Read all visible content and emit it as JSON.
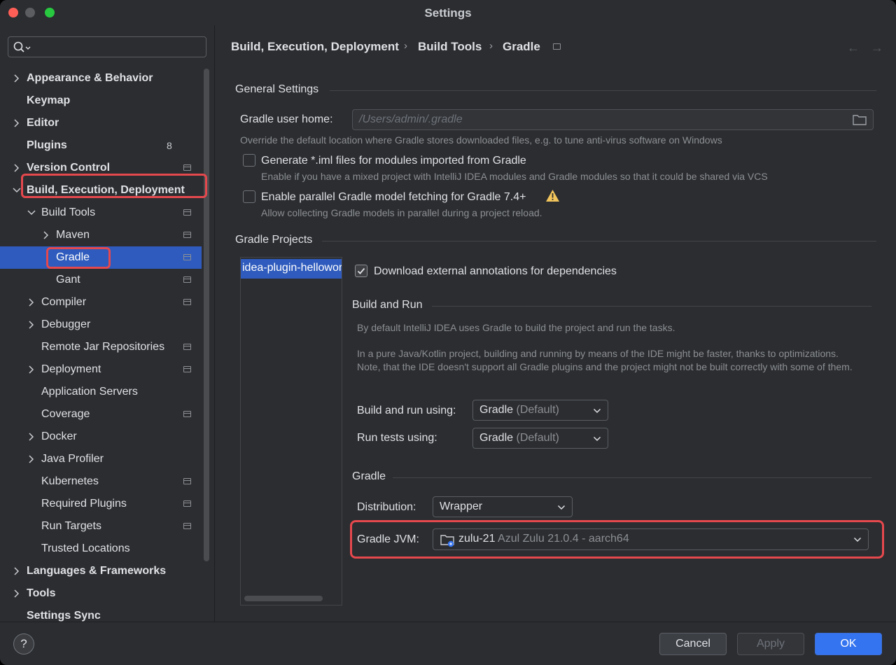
{
  "window": {
    "title": "Settings"
  },
  "sidebar": {
    "items": [
      {
        "label": "Appearance & Behavior"
      },
      {
        "label": "Keymap"
      },
      {
        "label": "Editor"
      },
      {
        "label": "Plugins",
        "badge": "8"
      },
      {
        "label": "Version Control"
      },
      {
        "label": "Build, Execution, Deployment"
      },
      {
        "label": "Build Tools"
      },
      {
        "label": "Maven"
      },
      {
        "label": "Gradle"
      },
      {
        "label": "Gant"
      },
      {
        "label": "Compiler"
      },
      {
        "label": "Debugger"
      },
      {
        "label": "Remote Jar Repositories"
      },
      {
        "label": "Deployment"
      },
      {
        "label": "Application Servers"
      },
      {
        "label": "Coverage"
      },
      {
        "label": "Docker"
      },
      {
        "label": "Java Profiler"
      },
      {
        "label": "Kubernetes"
      },
      {
        "label": "Required Plugins"
      },
      {
        "label": "Run Targets"
      },
      {
        "label": "Trusted Locations"
      },
      {
        "label": "Languages & Frameworks"
      },
      {
        "label": "Tools"
      },
      {
        "label": "Settings Sync"
      }
    ]
  },
  "breadcrumb": [
    "Build, Execution, Deployment",
    "Build Tools",
    "Gradle"
  ],
  "general": {
    "title": "General Settings",
    "user_home_label": "Gradle user home:",
    "user_home_value": "/Users/admin/.gradle",
    "user_home_hint": "Override the default location where Gradle stores downloaded files, e.g. to tune anti-virus software on Windows",
    "iml_label": "Generate *.iml files for modules imported from Gradle",
    "iml_hint": "Enable if you have a mixed project with IntelliJ IDEA modules and Gradle modules so that it could be shared via VCS",
    "parallel_label": "Enable parallel Gradle model fetching for Gradle 7.4+",
    "parallel_hint": "Allow collecting Gradle models in parallel during a project reload."
  },
  "projects": {
    "title": "Gradle Projects",
    "list": [
      "idea-plugin-helloworld"
    ],
    "download_annotations_label": "Download external annotations for dependencies",
    "build_run": {
      "title": "Build and Run",
      "hint1": "By default IntelliJ IDEA uses Gradle to build the project and run the tasks.",
      "hint2": "In a pure Java/Kotlin project, building and running by means of the IDE might be faster, thanks to optimizations. Note, that the IDE doesn't support all Gradle plugins and the project might not be built correctly with some of them.",
      "build_using_label": "Build and run using:",
      "build_using_value": "Gradle",
      "build_using_suffix": "(Default)",
      "tests_using_label": "Run tests using:",
      "tests_using_value": "Gradle",
      "tests_using_suffix": "(Default)"
    },
    "gradle": {
      "title": "Gradle",
      "distribution_label": "Distribution:",
      "distribution_value": "Wrapper",
      "jvm_label": "Gradle JVM:",
      "jvm_name": "zulu-21",
      "jvm_detail": "Azul Zulu 21.0.4 - aarch64"
    }
  },
  "footer": {
    "help": "?",
    "cancel": "Cancel",
    "apply": "Apply",
    "ok": "OK"
  },
  "colors": {
    "accent": "#3574f0",
    "selection": "#2e5bbd",
    "highlight": "#e5484d"
  }
}
